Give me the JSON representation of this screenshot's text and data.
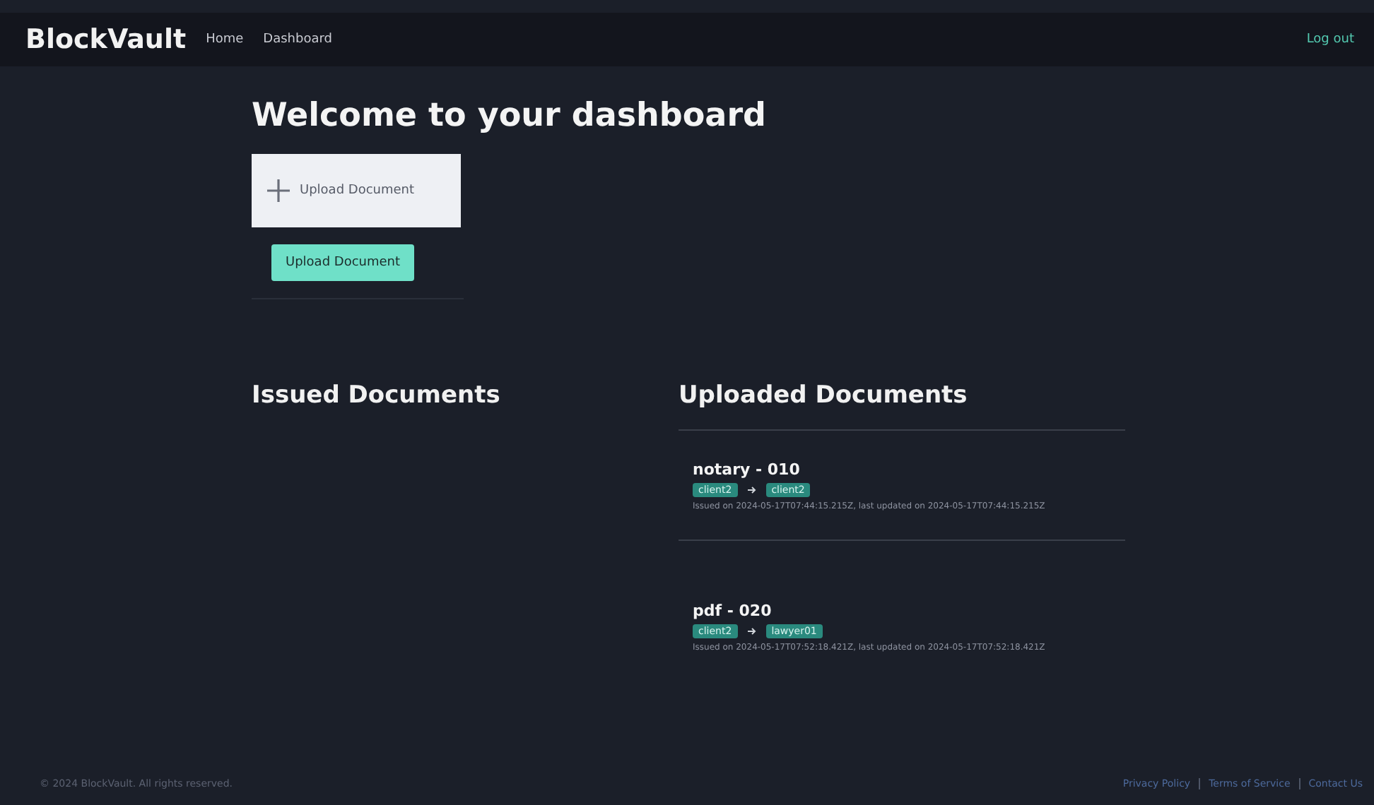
{
  "nav": {
    "brand": "BlockVault",
    "links": [
      "Home",
      "Dashboard"
    ],
    "logout": "Log out"
  },
  "heading": "Welcome to your dashboard",
  "upload": {
    "drop_label": "Upload Document",
    "button": "Upload Document"
  },
  "issued": {
    "title": "Issued Documents"
  },
  "uploaded": {
    "title": "Uploaded Documents",
    "documents": [
      {
        "name": "notary - 010",
        "from": "client2",
        "to": "client2",
        "meta": "Issued on 2024-05-17T07:44:15.215Z, last updated on 2024-05-17T07:44:15.215Z"
      },
      {
        "name": "pdf - 020",
        "from": "client2",
        "to": "lawyer01",
        "meta": "Issued on 2024-05-17T07:52:18.421Z, last updated on 2024-05-17T07:52:18.421Z"
      }
    ]
  },
  "footer": {
    "copyright": "© 2024 BlockVault. All rights reserved.",
    "links": [
      "Privacy Policy",
      "Terms of Service",
      "Contact Us"
    ]
  }
}
